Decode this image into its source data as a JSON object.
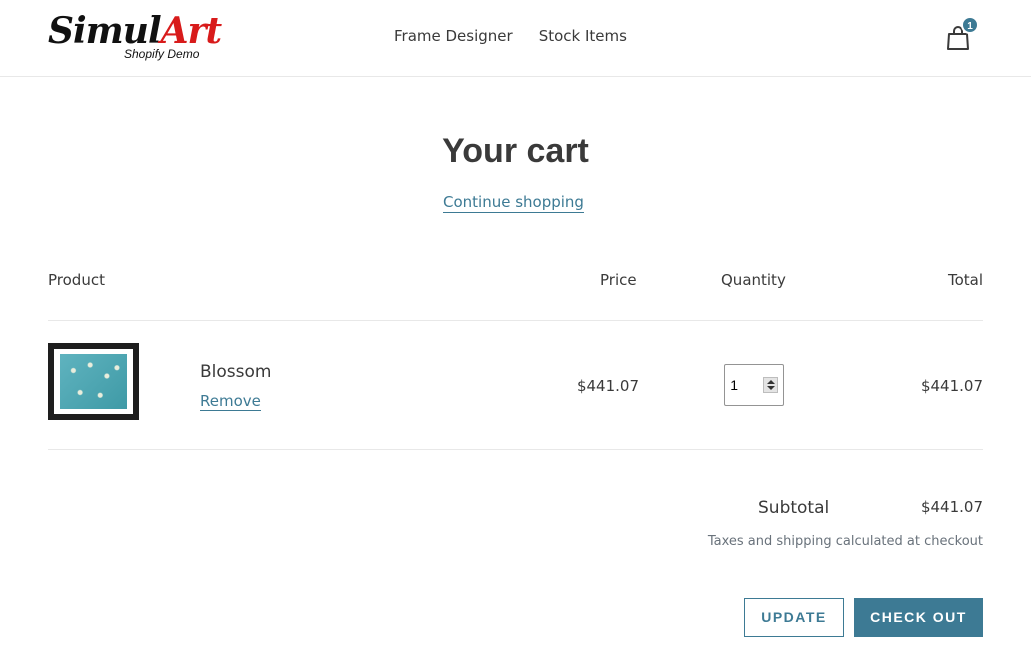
{
  "header": {
    "logo": {
      "main_dark": "Simul",
      "main_accent": "Art",
      "subtitle": "Shopify Demo"
    },
    "nav": [
      {
        "label": "Frame Designer"
      },
      {
        "label": "Stock Items"
      }
    ],
    "cart_icon": "shopping-bag-icon",
    "cart_count": "1"
  },
  "cart": {
    "title": "Your cart",
    "continue_label": "Continue shopping",
    "columns": {
      "product": "Product",
      "price": "Price",
      "quantity": "Quantity",
      "total": "Total"
    },
    "items": [
      {
        "name": "Blossom",
        "remove_label": "Remove",
        "price": "$441.07",
        "quantity": "1",
        "total": "$441.07"
      }
    ],
    "subtotal_label": "Subtotal",
    "subtotal_value": "$441.07",
    "tax_note": "Taxes and shipping calculated at checkout",
    "update_label": "UPDATE",
    "checkout_label": "CHECK OUT"
  },
  "colors": {
    "accent": "#3d7a94",
    "logo_red": "#d81b1b",
    "text": "#3a3a3a"
  }
}
